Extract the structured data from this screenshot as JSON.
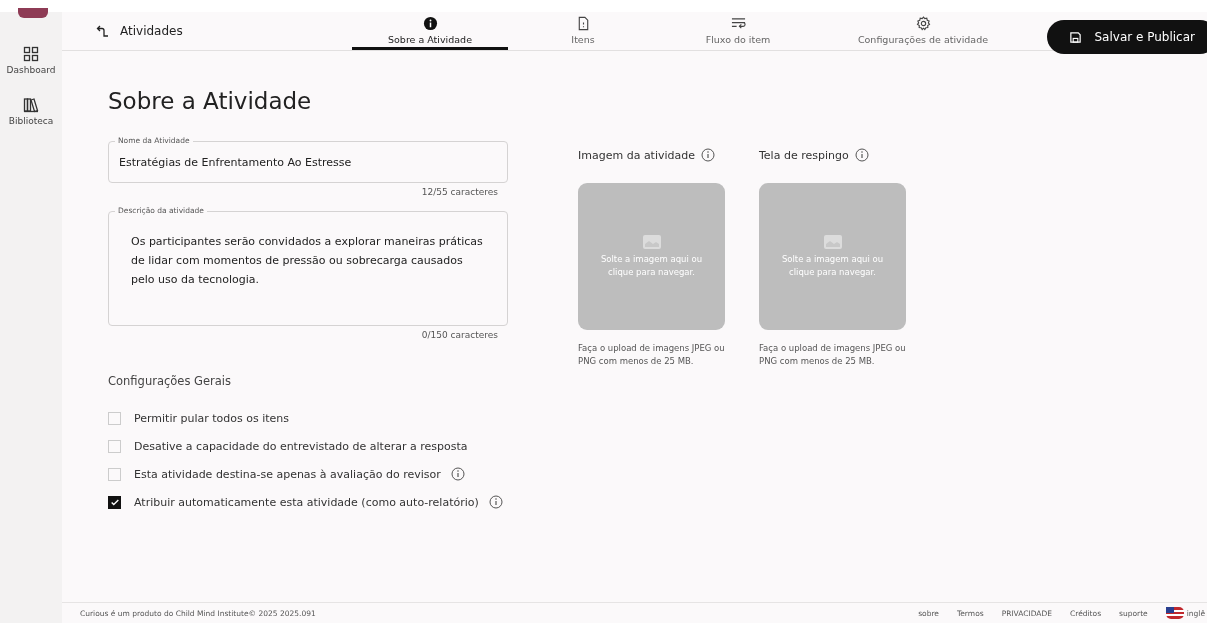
{
  "sidebar": {
    "items": [
      {
        "label": "Dashboard",
        "selected": false
      },
      {
        "label": "Biblioteca",
        "selected": false
      }
    ]
  },
  "header": {
    "back": "Atividades",
    "tabs": [
      {
        "label": "Sobre a Atividade",
        "selected": true
      },
      {
        "label": "Itens",
        "selected": false
      },
      {
        "label": "Fluxo do item",
        "selected": false
      },
      {
        "label": "Configurações de atividade",
        "selected": false
      }
    ],
    "save_button": "Salvar e Publicar"
  },
  "page_title": "Sobre a Atividade",
  "name_field": {
    "label": "Nome da Atividade",
    "value": "Estratégias de Enfrentamento Ao Estresse",
    "counter": "12/55 caracteres"
  },
  "description_field": {
    "label": "Descrição da atividade",
    "value": "Os participantes serão convidados a explorar maneiras práticas de lidar com momentos de pressão ou sobrecarga causados pelo uso da tecnologia.",
    "counter": "0/150 caracteres"
  },
  "uploads": [
    {
      "title": "Imagem da atividade",
      "drop_text": "Solte a imagem aqui ou clique para navegar.",
      "hint": "Faça o upload de imagens JPEG ou PNG com menos de 25 MB."
    },
    {
      "title": "Tela de respingo",
      "drop_text": "Solte a imagem aqui ou clique para navegar.",
      "hint": "Faça o upload de imagens JPEG ou PNG com menos de 25 MB."
    }
  ],
  "settings": {
    "title": "Configurações Gerais",
    "options": [
      {
        "label": "Permitir pular todos os itens",
        "checked": false,
        "info": false
      },
      {
        "label": "Desative a capacidade do entrevistado de alterar a resposta",
        "checked": false,
        "info": false
      },
      {
        "label": "Esta atividade destina-se apenas à avaliação do revisor",
        "checked": false,
        "info": true
      },
      {
        "label": "Atribuir automaticamente esta atividade (como auto-relatório)",
        "checked": true,
        "info": true
      }
    ]
  },
  "footer": {
    "credit": "Curious é um produto do  Child Mind Institute©  2025 2025.091",
    "links": [
      "sobre",
      "Termos",
      "PRIVACIDADE",
      "Créditos",
      "suporte"
    ],
    "language": "inglê"
  }
}
